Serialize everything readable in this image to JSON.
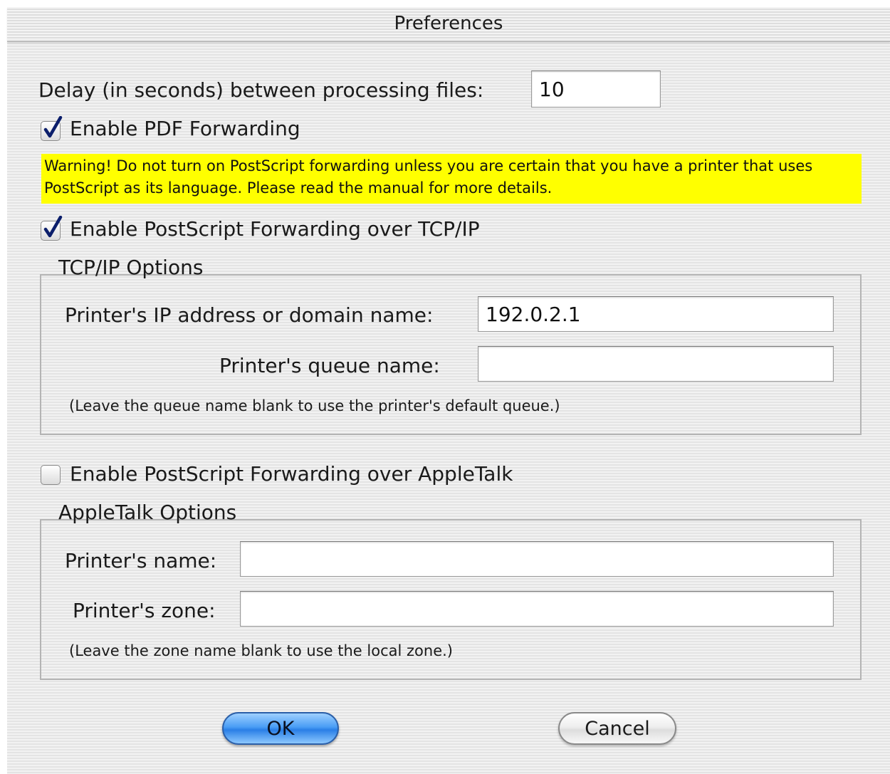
{
  "window": {
    "title": "Preferences"
  },
  "delay": {
    "label": "Delay (in seconds) between processing files:",
    "value": "10"
  },
  "pdf_forwarding": {
    "label": "Enable PDF Forwarding",
    "checked": true
  },
  "warning": {
    "text": "Warning! Do not turn on PostScript forwarding unless you are certain that you have a printer that uses PostScript as its language. Please read the manual for more details.",
    "color": "#ffff00"
  },
  "tcpip_forwarding": {
    "label": "Enable PostScript Forwarding over TCP/IP",
    "checked": true
  },
  "tcpip_options": {
    "legend": "TCP/IP Options",
    "ip_label": "Printer's IP address or domain name:",
    "ip_value": "192.0.2.1",
    "queue_label": "Printer's queue name:",
    "queue_value": "",
    "note": "(Leave the queue name blank to use the printer's default queue.)"
  },
  "appletalk_forwarding": {
    "label": "Enable PostScript Forwarding over AppleTalk",
    "checked": false
  },
  "appletalk_options": {
    "legend": "AppleTalk Options",
    "name_label": "Printer's name:",
    "name_value": "",
    "zone_label": "Printer's zone:",
    "zone_value": "",
    "note": "(Leave the zone name blank to use the local zone.)"
  },
  "buttons": {
    "ok_label": "OK",
    "cancel_label": "Cancel",
    "ok_color": "#4a9df5"
  },
  "icons": {
    "checkmark": "checkmark-icon"
  }
}
